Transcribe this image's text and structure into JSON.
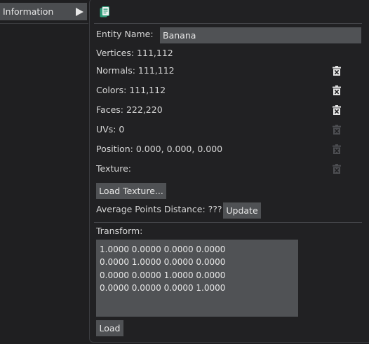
{
  "sidebar": {
    "tab_label": "Information"
  },
  "panel": {
    "entity_name_label": "Entity Name:",
    "entity_name_value": "Banana",
    "vertices": "Vertices: 111,112",
    "normals": "Normals: 111,112",
    "colors": "Colors: 111,112",
    "faces": "Faces: 222,220",
    "uvs": "UVs: 0",
    "position": "Position: 0.000, 0.000, 0.000",
    "texture": "Texture:",
    "load_texture_label": "Load Texture...",
    "avg_points_distance": "Average Points Distance: ???",
    "update_label": "Update",
    "transform_label": "Transform:",
    "transform_rows": [
      "1.0000 0.0000 0.0000 0.0000",
      "0.0000 1.0000 0.0000 0.0000",
      "0.0000 0.0000 1.0000 0.0000",
      "0.0000 0.0000 0.0000 1.0000"
    ],
    "load_label": "Load"
  },
  "icons": {
    "info_icon": "document-copy-icon",
    "delete_icon": "trash-icon"
  },
  "colors": {
    "background": "#1f1f21",
    "tab_background": "#4b4d50",
    "control_background": "#505255",
    "text": "#d7d7d7",
    "icon_active": "#e6e6e6",
    "icon_disabled": "#4d4e52",
    "accent_icon": "#2e9e7a"
  }
}
